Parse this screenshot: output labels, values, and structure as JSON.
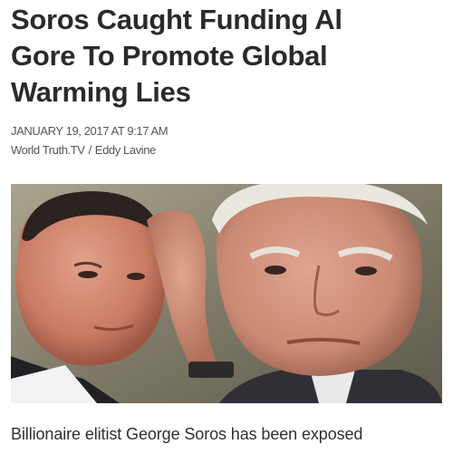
{
  "article": {
    "headline_lines": [
      "Soros Caught Funding Al",
      "Gore To Promote Global",
      "Warming Lies"
    ],
    "date": "JANUARY 19, 2017 AT 9:17 AM",
    "source": "World Truth.TV",
    "separator": "/",
    "author": "Eddy Lavine",
    "lead": "Billionaire elitist George Soros has been exposed"
  }
}
